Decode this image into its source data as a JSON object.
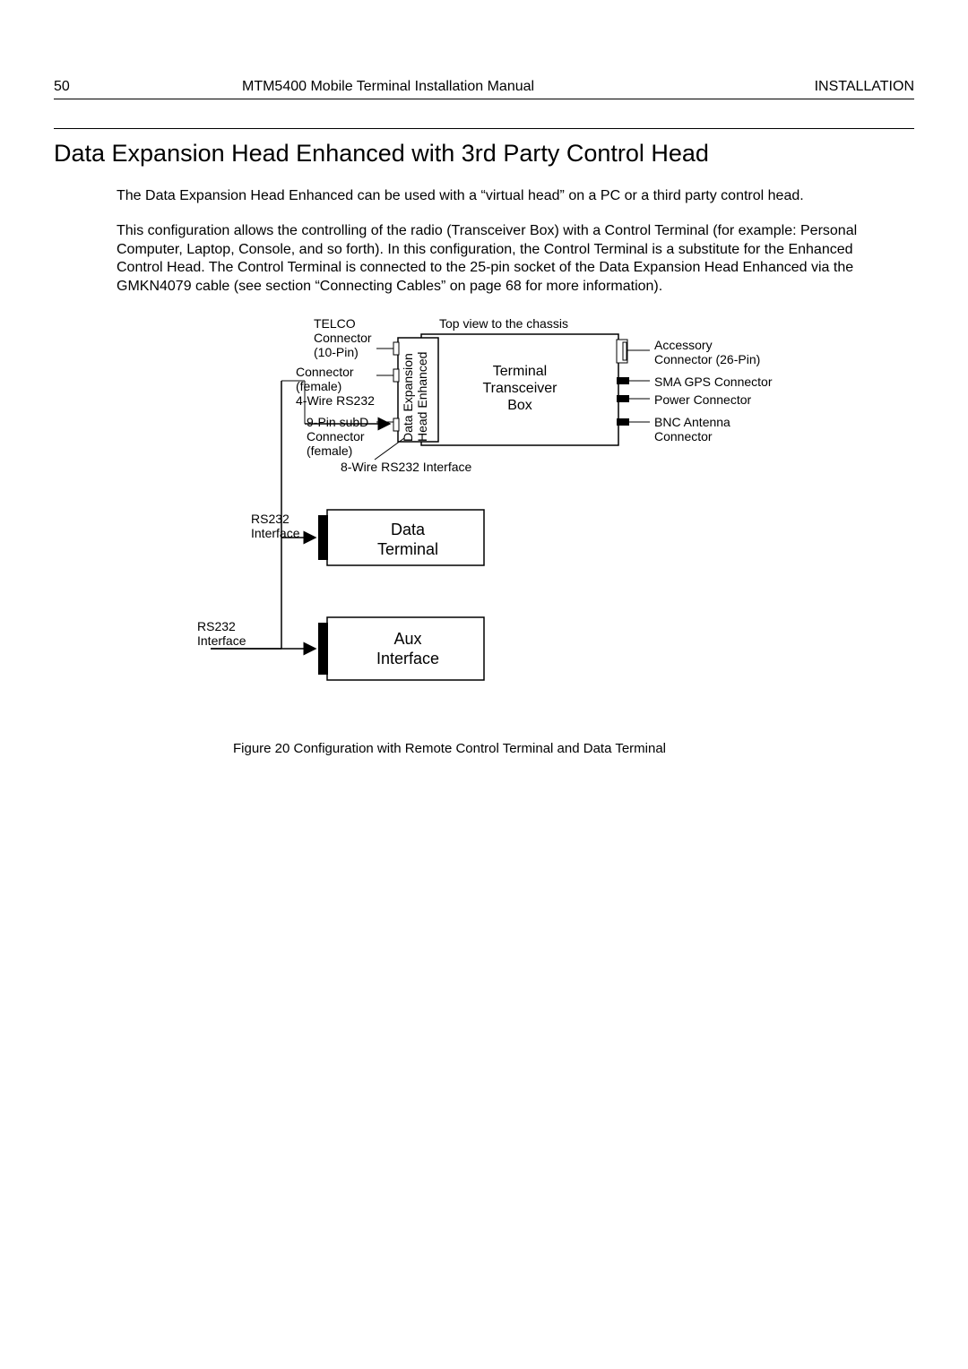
{
  "header": {
    "page_number": "50",
    "doc_title": "MTM5400 Mobile Terminal Installation Manual",
    "section": "INSTALLATION"
  },
  "heading": "Data Expansion Head Enhanced with 3rd Party Control Head",
  "p1": "The Data Expansion Head Enhanced can be used with a “virtual head” on a PC or a third party control head.",
  "p2": "This configuration allows the controlling of the radio (Transceiver Box) with a Control Terminal (for example: Personal Computer, Laptop, Console, and so forth). In this configuration, the Control Terminal is a substitute for the Enhanced Control Head. The Control Terminal is connected to the 25-pin socket of the Data Expansion Head Enhanced via the GMKN4079 cable (see section “Connecting Cables” on page 68 for more information).",
  "fig": {
    "top_view": "Top view to the chassis",
    "telco": "TELCO Connector (10-Pin)",
    "conn_female": "Connector (female) 4-Wire RS232",
    "subd9": "9-Pin subD Connector (female)",
    "rs232_8wire": "8-Wire RS232 Interface",
    "deh": "Data Expansion Head Enhanced",
    "transceiver": "Terminal Transceiver Box",
    "accessory": "Accessory Connector (26-Pin)",
    "sma": "SMA GPS Connector",
    "power": "Power Connector",
    "bnc": "BNC Antenna Connector",
    "rs232_a": "RS232 Interface",
    "rs232_b": "RS232 Interface",
    "data_term": "Data Terminal",
    "aux": "Aux Interface"
  },
  "caption": "Figure 20  Configuration with Remote Control Terminal and Data Terminal"
}
